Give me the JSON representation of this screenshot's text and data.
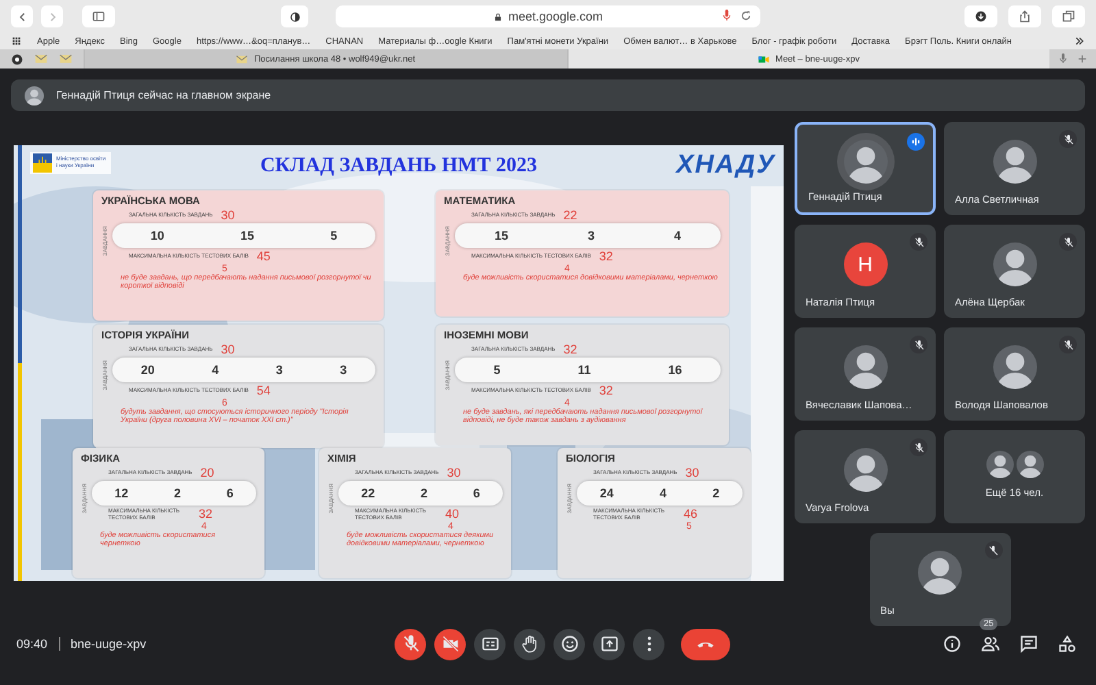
{
  "browser": {
    "address": "meet.google.com",
    "bookmarks": [
      "Apple",
      "Яндекс",
      "Bing",
      "Google",
      "https://www…&oq=планув…",
      "CHANAN",
      "Материалы ф…oogle Книги",
      "Пам'ятні монети України",
      "Обмен валют… в Харькове",
      "Блог - графік роботи",
      "Доставка",
      "Брэгт Поль. Книги онлайн"
    ],
    "tabs": [
      {
        "title": "Посилання школа 48 • wolf949@ukr.net",
        "selected": false
      },
      {
        "title": "Meet – bne-uuge-xpv",
        "selected": true
      }
    ]
  },
  "banner": "Геннадій Птиця сейчас на главном экране",
  "slide": {
    "ministry": "Міністерство освіти і науки України",
    "title": "СКЛАД ЗАВДАНЬ НМТ 2023",
    "logo": "ХНАДУ",
    "cards": [
      {
        "subject": "УКРАЇНСЬКА МОВА",
        "color": "#f4d6d6",
        "side": "ЗАВДАННЯ",
        "total_label": "ЗАГАЛЬНА КІЛЬКІСТЬ ЗАВДАНЬ",
        "total": "30",
        "tasks": [
          "10",
          "15",
          "5"
        ],
        "max_label": "МАКСИМАЛЬНА КІЛЬКІСТЬ ТЕСТОВИХ БАЛІВ",
        "max": "45",
        "pass": "5",
        "note": "не буде завдань, що передбачають надання письмової розгорнутої чи короткої відповіді"
      },
      {
        "subject": "МАТЕМАТИКА",
        "color": "#f4d6d6",
        "side": "ЗАВДАННЯ",
        "total_label": "ЗАГАЛЬНА КІЛЬКІСТЬ ЗАВДАНЬ",
        "total": "22",
        "tasks": [
          "15",
          "3",
          "4"
        ],
        "max_label": "МАКСИМАЛЬНА КІЛЬКІСТЬ ТЕСТОВИХ БАЛІВ",
        "max": "32",
        "pass": "4",
        "note": "буде можливість скористатися довідковими матеріалами, чернеткою"
      },
      {
        "subject": "ІСТОРІЯ УКРАЇНИ",
        "color": "#e2e2e4",
        "side": "ЗАВДАННЯ",
        "total_label": "ЗАГАЛЬНА КІЛЬКІСТЬ ЗАВДАНЬ",
        "total": "30",
        "tasks": [
          "20",
          "4",
          "3",
          "3"
        ],
        "max_label": "МАКСИМАЛЬНА КІЛЬКІСТЬ ТЕСТОВИХ БАЛІВ",
        "max": "54",
        "pass": "6",
        "note": "будуть завдання, що стосуються історичного періоду \"Історія України (друга половина XVI – початок XXI ст.)\""
      },
      {
        "subject": "ІНОЗЕМНІ МОВИ",
        "color": "#e2e2e4",
        "side": "ЗАВДАННЯ",
        "total_label": "ЗАГАЛЬНА КІЛЬКІСТЬ ЗАВДАНЬ",
        "total": "32",
        "tasks": [
          "5",
          "11",
          "16"
        ],
        "max_label": "МАКСИМАЛЬНА КІЛЬКІСТЬ ТЕСТОВИХ БАЛІВ",
        "max": "32",
        "pass": "4",
        "note": "не буде завдань, які передбачають надання письмової розгорнутої відповіді, не буде також завдань з аудіювання"
      },
      {
        "subject": "ФІЗИКА",
        "color": "#e2e2e4",
        "side": "ЗАВДАННЯ",
        "total_label": "ЗАГАЛЬНА КІЛЬКІСТЬ ЗАВДАНЬ",
        "total": "20",
        "tasks": [
          "12",
          "2",
          "6"
        ],
        "max_label": "МАКСИМАЛЬНА КІЛЬКІСТЬ ТЕСТОВИХ БАЛІВ",
        "max": "32",
        "pass": "4",
        "note": "буде можливість скористатися чернеткою"
      },
      {
        "subject": "ХІМІЯ",
        "color": "#e2e2e4",
        "side": "ЗАВДАННЯ",
        "total_label": "ЗАГАЛЬНА КІЛЬКІСТЬ ЗАВДАНЬ",
        "total": "30",
        "tasks": [
          "22",
          "2",
          "6"
        ],
        "max_label": "МАКСИМАЛЬНА КІЛЬКІСТЬ ТЕСТОВИХ БАЛІВ",
        "max": "40",
        "pass": "4",
        "note": "буде можливість скористатися деякими довідковими матеріалами, чернеткою"
      },
      {
        "subject": "БІОЛОГІЯ",
        "color": "#e2e2e4",
        "side": "ЗАВДАННЯ",
        "total_label": "ЗАГАЛЬНА КІЛЬКІСТЬ ЗАВДАНЬ",
        "total": "30",
        "tasks": [
          "24",
          "4",
          "2"
        ],
        "max_label": "МАКСИМАЛЬНА КІЛЬКІСТЬ ТЕСТОВИХ БАЛІВ",
        "max": "46",
        "pass": "5"
      }
    ]
  },
  "participants": [
    {
      "name": "Геннадій Птиця",
      "muted": false,
      "speaking": true
    },
    {
      "name": "Алла Светличная",
      "muted": true,
      "speaking": false
    },
    {
      "name": "Наталія Птиця",
      "kind": "letter",
      "letter": "Н",
      "muted": true,
      "speaking": false
    },
    {
      "name": "Алёна Щербак",
      "muted": true,
      "speaking": false
    },
    {
      "name": "Вячеславик Шапова…",
      "muted": true,
      "speaking": false
    },
    {
      "name": "Володя Шаповалов",
      "muted": true,
      "speaking": false
    },
    {
      "name": "Varya Frolova",
      "muted": true,
      "speaking": false
    }
  ],
  "more": "Ещё 16 чел.",
  "self": {
    "name": "Вы",
    "muted": true
  },
  "bottom": {
    "time": "09:40",
    "code": "bne-uuge-xpv",
    "controls": [
      {
        "kind": "mic",
        "off": true
      },
      {
        "kind": "camera",
        "off": true
      },
      {
        "kind": "captions",
        "off": false
      },
      {
        "kind": "hand",
        "off": false
      },
      {
        "kind": "emoji",
        "off": false
      },
      {
        "kind": "present",
        "off": false
      },
      {
        "kind": "more",
        "off": false
      },
      {
        "kind": "end"
      }
    ],
    "people_count": "25"
  }
}
